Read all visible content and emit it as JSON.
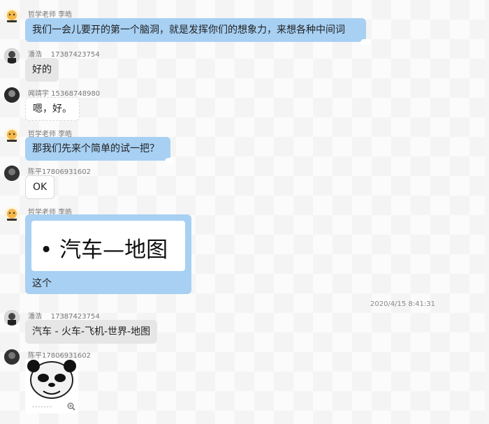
{
  "chat": {
    "messages": [
      {
        "sender": "哲学老师 李皓",
        "text": "我们一会儿要开的第一个脑洞，就是发挥你们的想象力，来想各种中间词"
      },
      {
        "sender": "潘浩",
        "phone": "17387423754",
        "text": "好的"
      },
      {
        "sender": "闻靖宇 15368748980",
        "text": "嗯，好。"
      },
      {
        "sender": "哲学老师 李皓",
        "text": "那我们先来个简单的试一把？"
      },
      {
        "sender": "陈平17806931602",
        "text": "OK"
      },
      {
        "sender": "哲学老师 李皓",
        "slide_text": "• 汽车—地图",
        "caption": "这个"
      },
      {
        "sender": "潘浩",
        "phone": "17387423754",
        "text": "汽车 - 火车-飞机-世界-地图"
      },
      {
        "sender": "陈平17806931602",
        "sticker": "panda-meme-sticker",
        "dots": "·······"
      }
    ],
    "timestamp": "2020/4/15 8:41:31"
  },
  "icons": {
    "zoom": "magnifier-plus-icon"
  },
  "colors": {
    "teacher_bubble": "#a7d0f3",
    "student_bubble": "#e6e6e6",
    "name_text": "#777777"
  }
}
